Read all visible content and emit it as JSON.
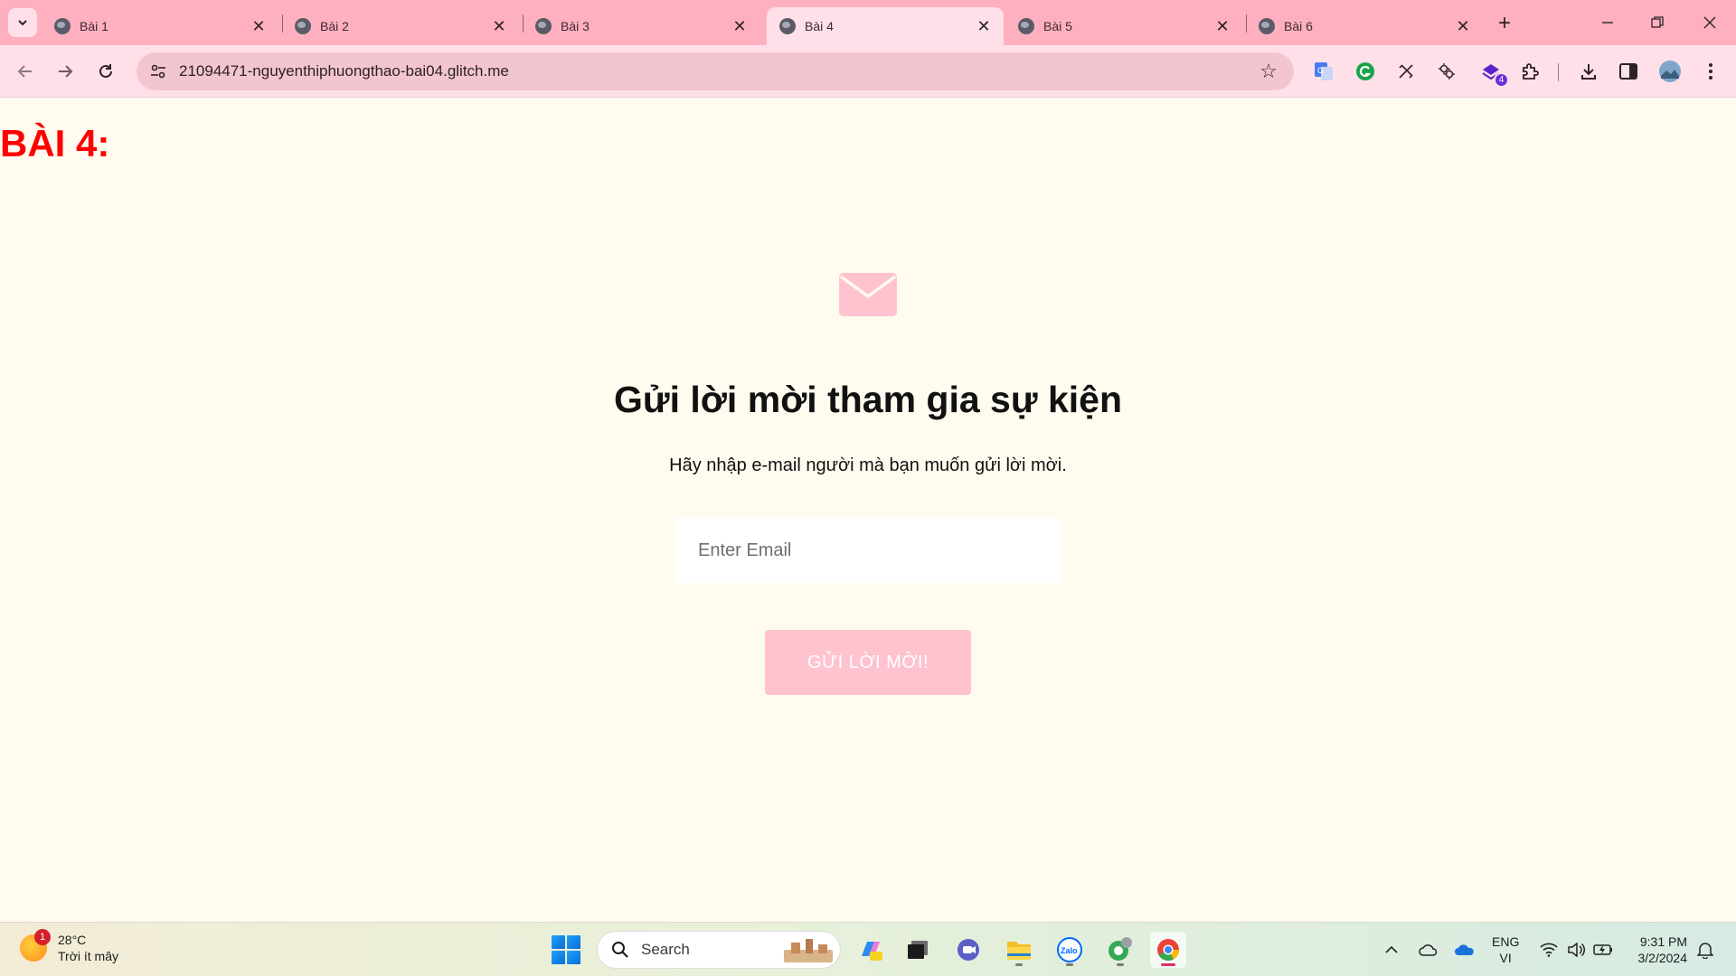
{
  "browser": {
    "tabs": [
      {
        "label": "Bài 1",
        "active": false
      },
      {
        "label": "Bài 2",
        "active": false
      },
      {
        "label": "Bài 3",
        "active": false
      },
      {
        "label": "Bài 4",
        "active": true
      },
      {
        "label": "Bài 5",
        "active": false
      },
      {
        "label": "Bài 6",
        "active": false
      }
    ],
    "url": "21094471-nguyenthiphuongthao-bai04.glitch.me",
    "extension_badge": "4",
    "colors": {
      "tabstrip": "#ffb0c0",
      "toolbar": "#ffe0e8",
      "omnibox": "#f3c5d0"
    }
  },
  "page": {
    "heading": "BÀI 4:",
    "title": "Gửi lời mời tham gia sự kiện",
    "description": "Hãy nhập e-mail người mà bạn muốn gửi lời mời.",
    "email_placeholder": "Enter Email",
    "email_value": "",
    "button_label": "GỬI LỜI MỜI!",
    "colors": {
      "heading": "#ff0000",
      "accent": "#ffc3cf",
      "background": "#fffbee"
    }
  },
  "taskbar": {
    "weather": {
      "temp": "28°C",
      "condition": "Trời ít mây",
      "badge": "1"
    },
    "search_label": "Search",
    "language": {
      "line1": "ENG",
      "line2": "VI"
    },
    "clock": {
      "time": "9:31 PM",
      "date": "3/2/2024"
    }
  }
}
